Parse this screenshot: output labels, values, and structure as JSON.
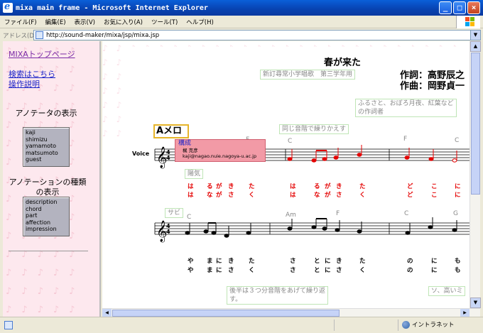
{
  "window": {
    "title": "mixa main frame - Microsoft Internet Explorer",
    "buttons": {
      "minimize": "_",
      "maximize": "□",
      "close": "×"
    }
  },
  "menu": {
    "items": [
      "ファイル(F)",
      "編集(E)",
      "表示(V)",
      "お気に入り(A)",
      "ツール(T)",
      "ヘルプ(H)"
    ]
  },
  "address": {
    "label": "アドレス(D)",
    "url": "http://sound-maker/mixa/jsp/mixa.jsp"
  },
  "sidebar": {
    "top_link": "MIXAトップページ",
    "search_link": "検索はこちら",
    "help_link": "操作説明",
    "annotator_heading": "アノテータの表示",
    "annotators": [
      "kaji",
      "shimizu",
      "yamamoto",
      "matsumoto",
      "guest"
    ],
    "annotation_type_heading_1": "アノテーションの種類",
    "annotation_type_heading_2": "の表示",
    "annotation_types": [
      "description",
      "chord",
      "part",
      "affection",
      "impression"
    ]
  },
  "score": {
    "song_title": "春が来た",
    "song_source": "新訂尋常小学唱歌　第三学年用",
    "lyricist": "作詞：高野辰之",
    "composer": "作曲：岡野貞一",
    "note_top_right_1": "ふるさと、おぼろ月夜、紅葉など",
    "note_top_right_2": "の作詞者",
    "section_a": "Aメロ",
    "repeat_note": "同じ音階で繰りかえす",
    "popup_title": "構成",
    "popup_author": "梶 克彦",
    "popup_email": "kaji@nagao.nuie.nagoya-u.ac.jp",
    "mood_label": "陽気",
    "sabi_label": "サビ",
    "voice_label": "Voice",
    "bottom_note_1": "後半は３つ分音階をあげて繰り返",
    "bottom_note_2": "す。",
    "bottom_note_right": "ソ、高いミ",
    "chords_row1": [
      "F",
      "C",
      "F",
      "C"
    ],
    "chords_row2": [
      "C",
      "Am",
      "F",
      "C",
      "G"
    ],
    "lyrics_row1a": [
      "は",
      "る",
      "が",
      "き",
      "た",
      "は",
      "る",
      "が",
      "き",
      "た",
      "ど",
      "こ",
      "に"
    ],
    "lyrics_row1b": [
      "は",
      "な",
      "が",
      "さ",
      "く",
      "は",
      "な",
      "が",
      "さ",
      "く",
      "ど",
      "こ",
      "に"
    ],
    "lyrics_row2a": [
      "や",
      "ま",
      "に",
      "き",
      "た",
      "さ",
      "と",
      "に",
      "き",
      "た",
      "の",
      "に",
      "も"
    ],
    "lyrics_row2b": [
      "や",
      "ま",
      "に",
      "さ",
      "く",
      "さ",
      "と",
      "に",
      "さ",
      "く",
      "の",
      "に",
      "も"
    ]
  },
  "status": {
    "zone": "イントラネット"
  },
  "colors": {
    "note_red": "#e40000",
    "label_border": "#bfe5b6",
    "popup_bg": "#f29aa6",
    "section_border": "#e6b52a"
  }
}
